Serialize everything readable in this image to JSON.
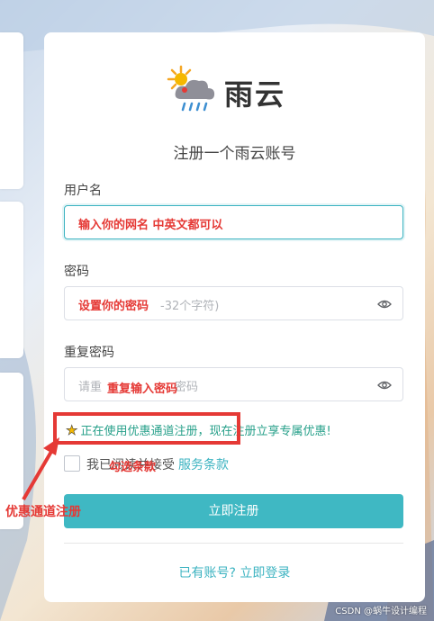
{
  "logo": {
    "text": "雨云",
    "icon": "sun-cloud-rain-icon"
  },
  "form": {
    "title": "注册一个雨云账号",
    "username": {
      "label": "用户名",
      "placeholder": "",
      "annotation": "输入你的网名 中英文都可以"
    },
    "password": {
      "label": "密码",
      "placeholder": "-32个字符)",
      "annotation": "设置你的密码"
    },
    "confirm": {
      "label": "重复密码",
      "placeholder": "请重",
      "placeholder_tail": "密码",
      "annotation": "重复输入密码"
    },
    "promo": "正在使用优惠通道注册，现在注册立享专属优惠!",
    "agree_prefix": "我已阅读并接受",
    "agree_link": "服务条款",
    "agree_annotation": "勾选条款",
    "submit_label": "立即注册",
    "login_link": "已有账号? 立即登录"
  },
  "annotations": {
    "side_label": "优惠通道注册"
  },
  "watermark": "CSDN @蜗牛设计编程",
  "colors": {
    "accent": "#3fb8c3",
    "promo_green": "#27a08a",
    "annotation_red": "#e53935"
  }
}
